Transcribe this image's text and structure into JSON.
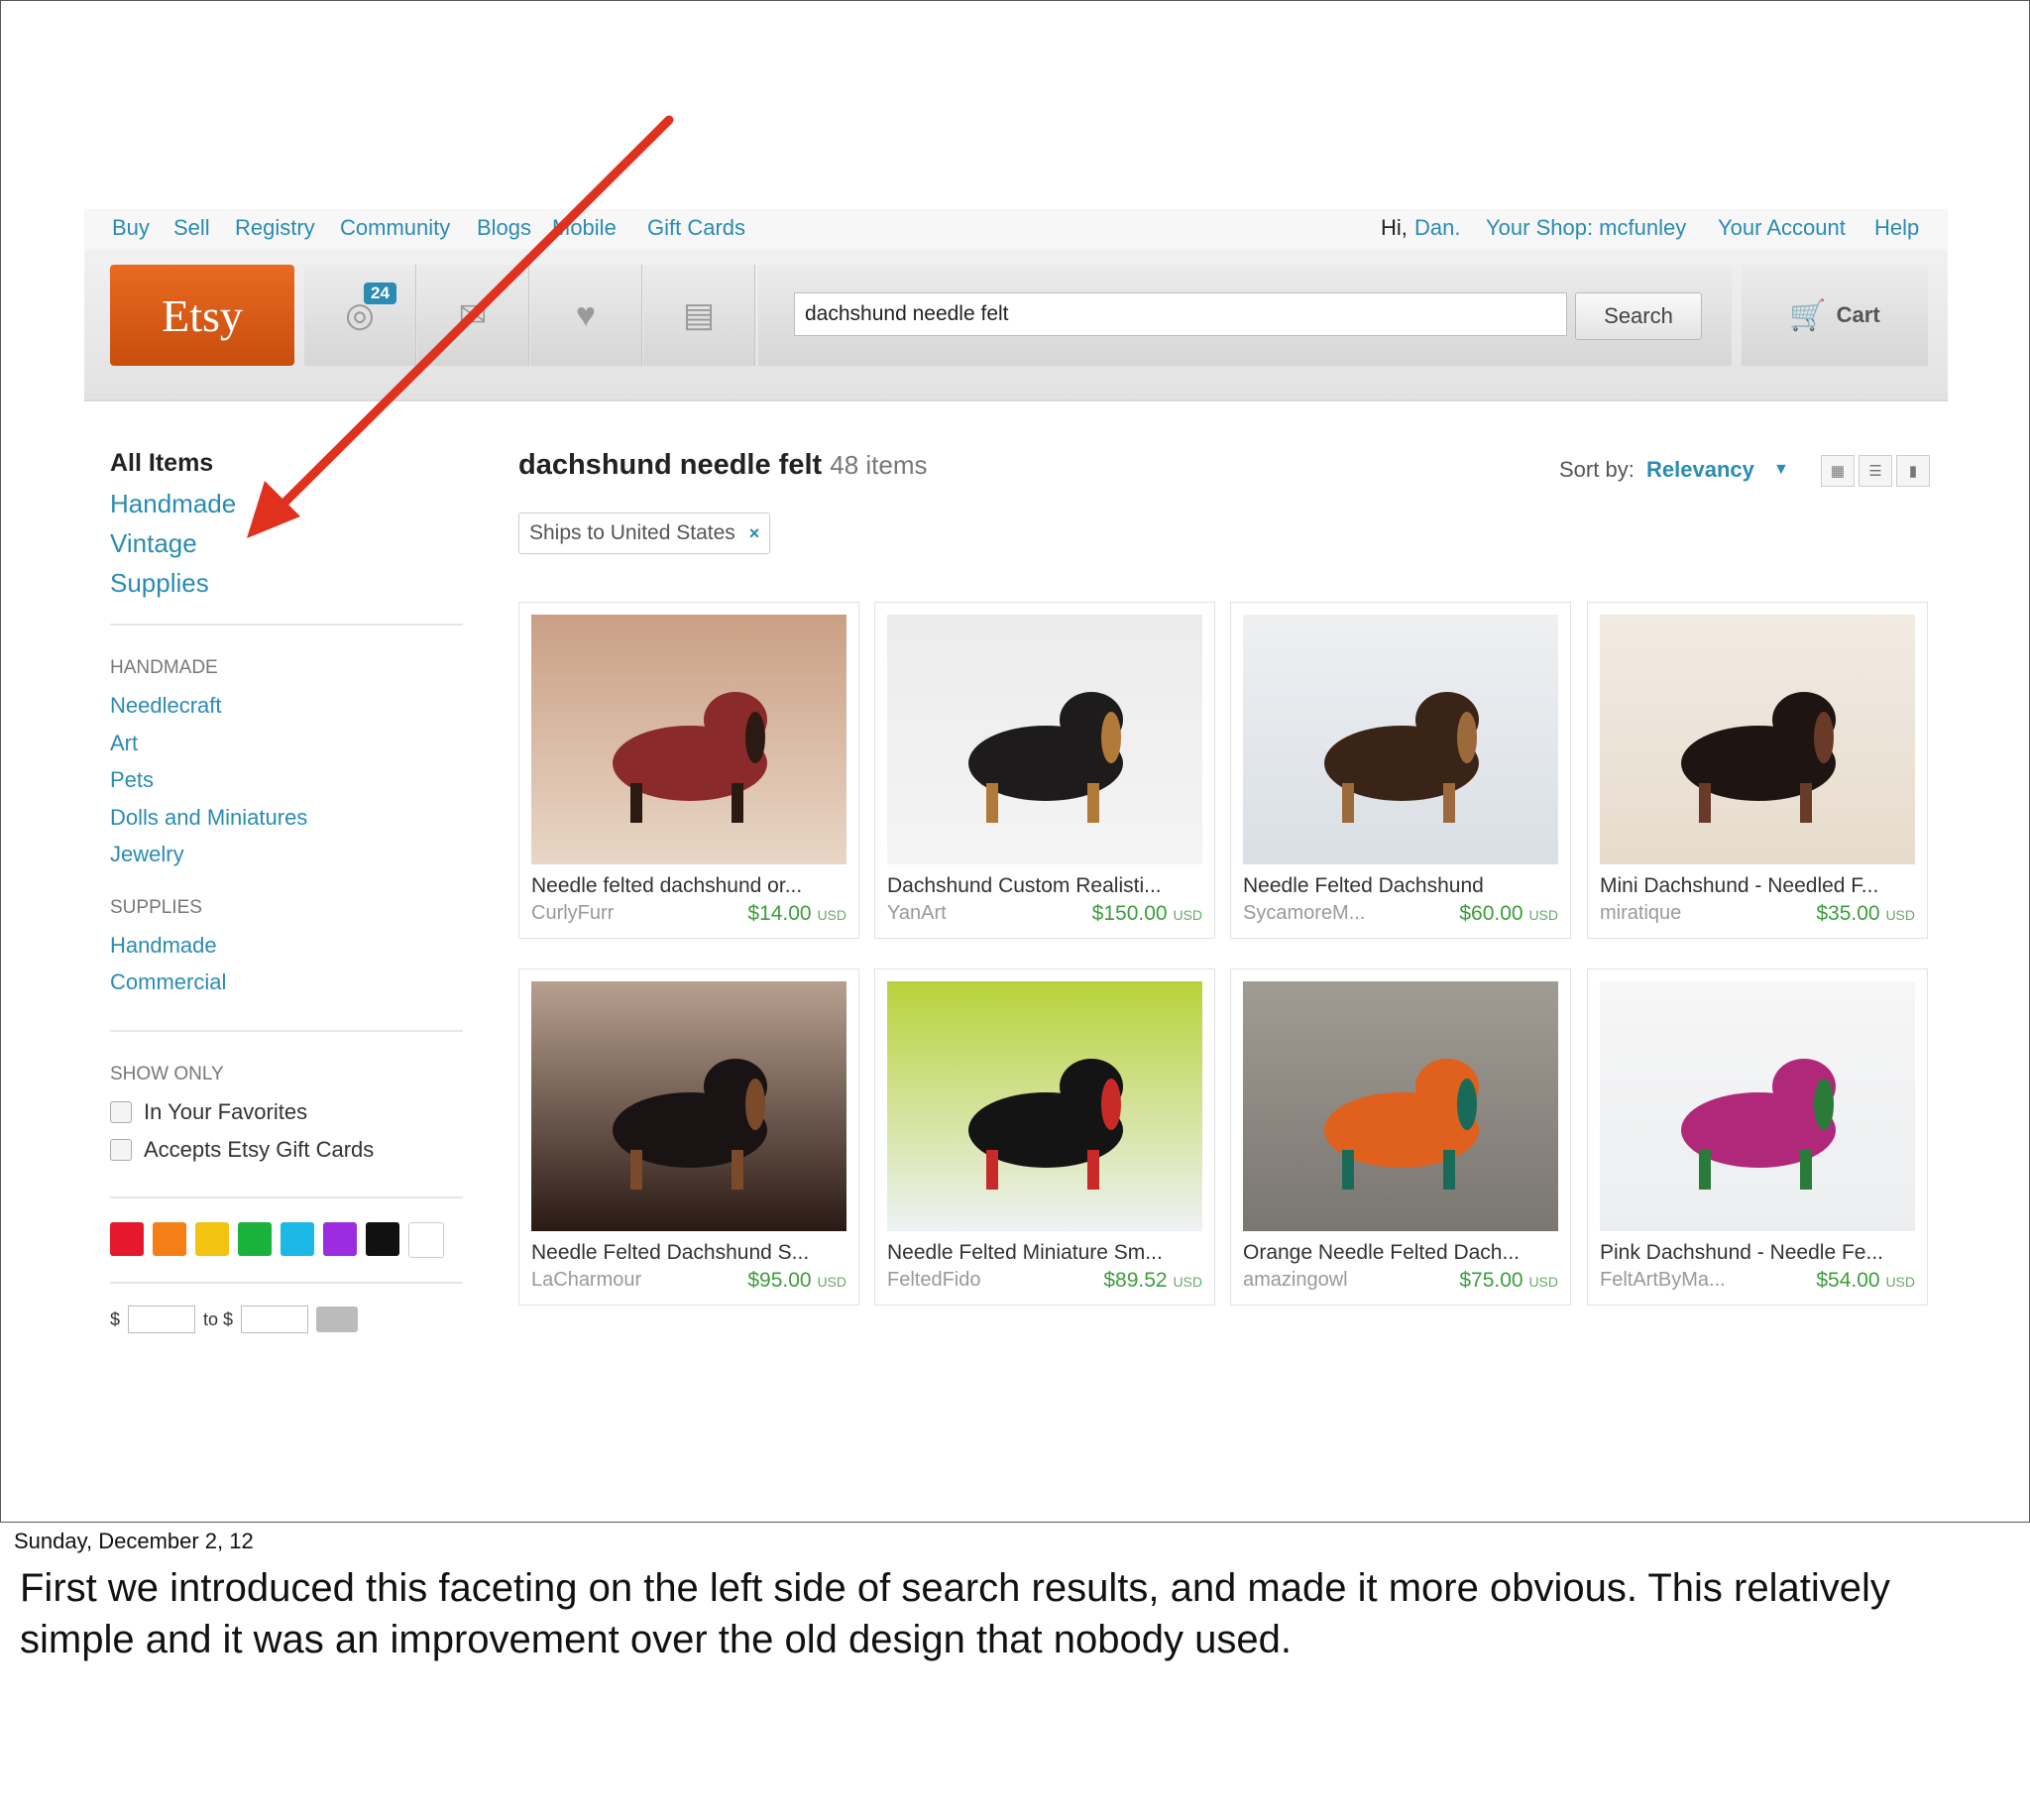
{
  "topnav": {
    "links": [
      "Buy",
      "Sell",
      "Registry",
      "Community",
      "Blogs",
      "Mobile",
      "Gift Cards"
    ],
    "greeting": "Hi,",
    "user": "Dan.",
    "shop": "Your Shop: mcfunley",
    "account": "Your Account",
    "help": "Help"
  },
  "header": {
    "logo": "Etsy",
    "activity_badge": "24",
    "search_value": "dachshund needle felt",
    "search_button": "Search",
    "cart_label": "Cart",
    "icons": [
      "activity-icon",
      "message-icon",
      "heart-icon",
      "shop-icon",
      "cart-icon"
    ]
  },
  "sidebar": {
    "top": [
      "All Items",
      "Handmade",
      "Vintage",
      "Supplies"
    ],
    "handmade_heading": "HANDMADE",
    "handmade_items": [
      "Needlecraft",
      "Art",
      "Pets",
      "Dolls and Miniatures",
      "Jewelry"
    ],
    "supplies_heading": "SUPPLIES",
    "supplies_items": [
      "Handmade",
      "Commercial"
    ],
    "show_only_heading": "SHOW ONLY",
    "show_only": [
      "In Your Favorites",
      "Accepts Etsy Gift Cards"
    ],
    "colors": [
      "#e5182d",
      "#f57f17",
      "#f2c40f",
      "#1ab23a",
      "#1cb8e6",
      "#9b2ce0",
      "#111111",
      "#ffffff"
    ],
    "price_prefix": "$",
    "price_to": "to $"
  },
  "results": {
    "query": "dachshund needle felt",
    "count": "48 items",
    "sort_label": "Sort by:",
    "sort_value": "Relevancy",
    "filter_chip": "Ships to United States",
    "filter_remove": "×",
    "items": [
      {
        "title": "Needle felted dachshund or...",
        "shop": "CurlyFurr",
        "price": "$14.00",
        "currency": "USD"
      },
      {
        "title": "Dachshund Custom Realisti...",
        "shop": "YanArt",
        "price": "$150.00",
        "currency": "USD"
      },
      {
        "title": "Needle Felted Dachshund",
        "shop": "SycamoreM...",
        "price": "$60.00",
        "currency": "USD"
      },
      {
        "title": "Mini Dachshund - Needled F...",
        "shop": "miratique",
        "price": "$35.00",
        "currency": "USD"
      },
      {
        "title": "Needle Felted Dachshund S...",
        "shop": "LaCharmour",
        "price": "$95.00",
        "currency": "USD"
      },
      {
        "title": "Needle Felted Miniature Sm...",
        "shop": "FeltedFido",
        "price": "$89.52",
        "currency": "USD"
      },
      {
        "title": "Orange Needle Felted Dach...",
        "shop": "amazingowl",
        "price": "$75.00",
        "currency": "USD"
      },
      {
        "title": "Pink Dachshund - Needle Fe...",
        "shop": "FeltArtByMa...",
        "price": "$54.00",
        "currency": "USD"
      }
    ]
  },
  "annotation": {
    "arrow_color": "#e0301e"
  },
  "footer": {
    "date": "Sunday, December 2, 12",
    "note": "First we introduced this faceting on the left side of search results, and made it more obvious. This relatively simple and it was an improvement over the old design that nobody used."
  }
}
